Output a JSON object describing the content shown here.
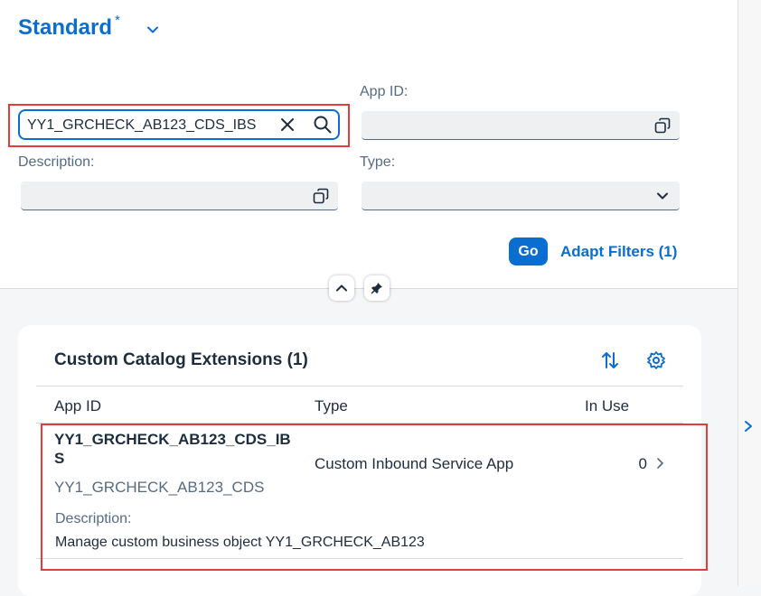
{
  "variant": {
    "title": "Standard",
    "modified_marker": "*"
  },
  "filters": {
    "search": {
      "value": "YY1_GRCHECK_AB123_CDS_IBS",
      "placeholder": ""
    },
    "app_id": {
      "label": "App ID:",
      "value": ""
    },
    "description": {
      "label": "Description:",
      "value": ""
    },
    "type": {
      "label": "Type:",
      "value": ""
    }
  },
  "actions": {
    "go_label": "Go",
    "adapt_filters_label": "Adapt Filters (1)"
  },
  "table": {
    "title": "Custom Catalog Extensions (1)",
    "columns": [
      "App ID",
      "Type",
      "In Use"
    ],
    "rows": [
      {
        "app_id": "YY1_GRCHECK_AB123_CDS_IBS",
        "app_id_sub": "YY1_GRCHECK_AB123_CDS",
        "type": "Custom Inbound Service App",
        "in_use": "0",
        "description_label": "Description:",
        "description": "Manage custom business object YY1_GRCHECK_AB123"
      }
    ]
  },
  "icons": {
    "variant_dropdown": "chevron-down-icon",
    "clear": "clear-icon",
    "search": "search-icon",
    "value_help": "value-help-icon",
    "type_dropdown": "chevron-down-icon",
    "collapse": "chevron-up-icon",
    "pin": "pin-icon",
    "sort": "sort-icon",
    "settings": "gear-icon",
    "row_navigation": "chevron-right-icon",
    "side_panel_expand": "chevron-right-icon"
  },
  "colors": {
    "brand": "#0a6ed1",
    "highlight_box": "#e63b3b",
    "text": "#1d2d3e",
    "secondary_text": "#556b82"
  }
}
